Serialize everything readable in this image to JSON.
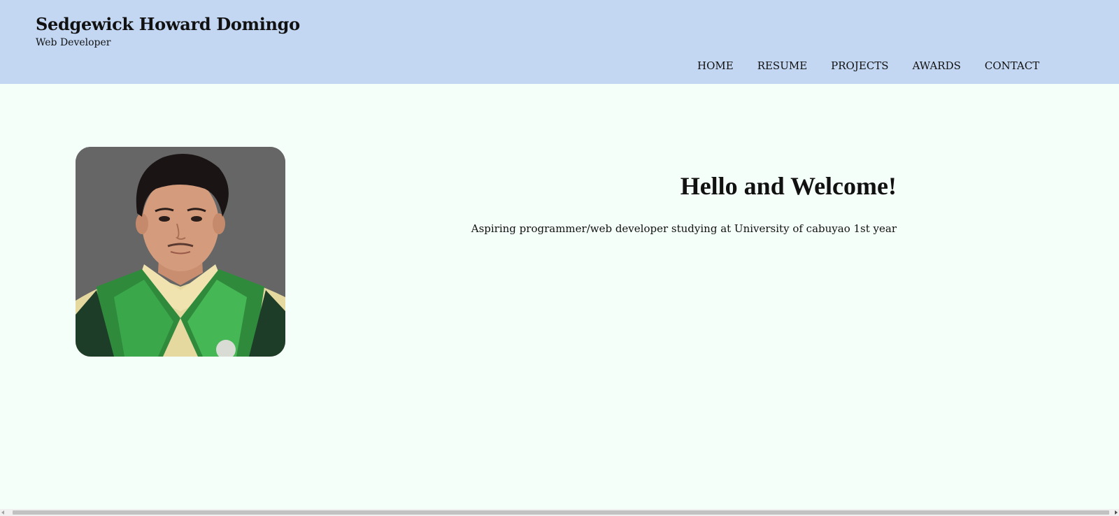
{
  "header": {
    "name": "Sedgewick Howard Domingo",
    "role": "Web Developer",
    "background_color": "#c3d7f3"
  },
  "nav": {
    "items": [
      {
        "label": "HOME"
      },
      {
        "label": "RESUME"
      },
      {
        "label": "PROJECTS"
      },
      {
        "label": "AWARDS"
      },
      {
        "label": "CONTACT"
      }
    ]
  },
  "main": {
    "background_color": "#f5fff9",
    "welcome_title": "Hello and Welcome!",
    "welcome_text": "Aspiring programmer/web developer studying at University of cabuyao 1st year",
    "photo_icon": "profile-photo"
  },
  "scrollbar": {
    "orientation": "horizontal"
  }
}
